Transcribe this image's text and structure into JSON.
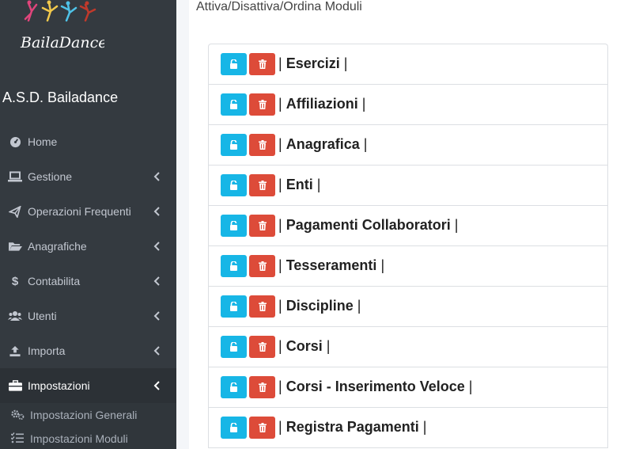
{
  "sidebar": {
    "logo_text": "BailaDance",
    "brand": "A.S.D. Bailadance",
    "items": [
      {
        "label": "Home",
        "icon": "tachometer-icon",
        "has_children": false
      },
      {
        "label": "Gestione",
        "icon": "laptop-icon",
        "has_children": true
      },
      {
        "label": "Operazioni Frequenti",
        "icon": "paper-plane-icon",
        "has_children": true
      },
      {
        "label": "Anagrafiche",
        "icon": "folder-open-icon",
        "has_children": true
      },
      {
        "label": "Contabilita",
        "icon": "dollar-icon",
        "has_children": true
      },
      {
        "label": "Utenti",
        "icon": "users-icon",
        "has_children": true
      },
      {
        "label": "Importa",
        "icon": "upload-icon",
        "has_children": true
      },
      {
        "label": "Impostazioni",
        "icon": "toolbox-icon",
        "has_children": true,
        "active": true
      }
    ],
    "subitems": [
      {
        "label": "Impostazioni Generali",
        "icon": "cogs-icon"
      },
      {
        "label": "Impostazioni Moduli",
        "icon": "tasks-icon"
      }
    ]
  },
  "main": {
    "title": "Attiva/Disattiva/Ordina Moduli",
    "modules": [
      {
        "name": "Esercizi"
      },
      {
        "name": "Affiliazioni"
      },
      {
        "name": "Anagrafica"
      },
      {
        "name": "Enti"
      },
      {
        "name": "Pagamenti Collaboratori"
      },
      {
        "name": "Tesseramenti"
      },
      {
        "name": "Discipline"
      },
      {
        "name": "Corsi"
      },
      {
        "name": "Corsi - Inserimento Veloce"
      },
      {
        "name": "Registra Pagamenti"
      }
    ],
    "separator": "|"
  },
  "colors": {
    "sidebar_bg": "#343a40",
    "unlock_button": "#17b6e6",
    "delete_button": "#dd4b39"
  }
}
